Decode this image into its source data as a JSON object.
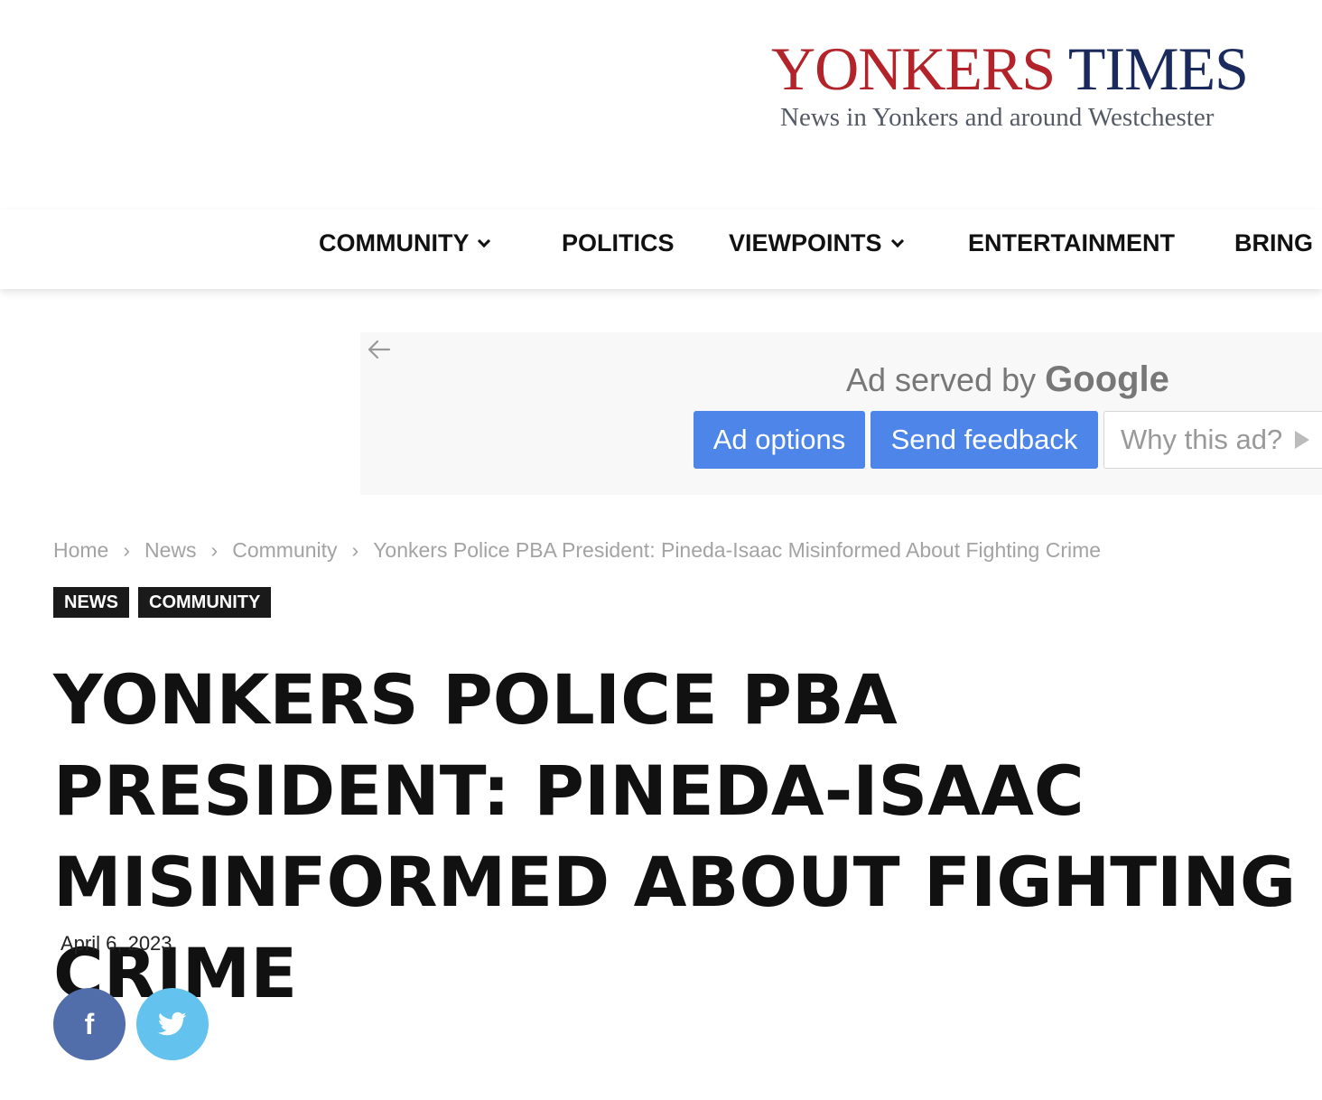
{
  "header": {
    "logo_word1": "YONKERS",
    "logo_word2": "TIMES",
    "tagline": "News in Yonkers and around Westchester"
  },
  "nav": {
    "items": [
      {
        "label": "COMMUNITY",
        "has_dropdown": true
      },
      {
        "label": "POLITICS",
        "has_dropdown": false
      },
      {
        "label": "VIEWPOINTS",
        "has_dropdown": true
      },
      {
        "label": "ENTERTAINMENT",
        "has_dropdown": false
      },
      {
        "label": "BRING",
        "has_dropdown": false
      }
    ]
  },
  "ad": {
    "served_prefix": "Ad served by",
    "served_brand": "Google",
    "options_label": "Ad options",
    "feedback_label": "Send feedback",
    "why_label": "Why this ad?"
  },
  "breadcrumb": {
    "items": [
      "Home",
      "News",
      "Community",
      "Yonkers Police PBA President: Pineda-Isaac Misinformed About Fighting Crime"
    ],
    "separator": "›"
  },
  "tags": [
    "NEWS",
    "COMMUNITY"
  ],
  "article": {
    "title": "YONKERS POLICE PBA PRESIDENT: PINEDA-ISAAC MISINFORMED ABOUT FIGHTING CRIME",
    "date": "April 6, 2023"
  },
  "social": {
    "facebook_glyph": "f",
    "colors": {
      "facebook": "#516eab",
      "twitter": "#63c2ee"
    }
  },
  "colors": {
    "logo_red": "#b3232a",
    "logo_navy": "#1b2a5c",
    "ad_button_blue": "#4d86e8"
  }
}
